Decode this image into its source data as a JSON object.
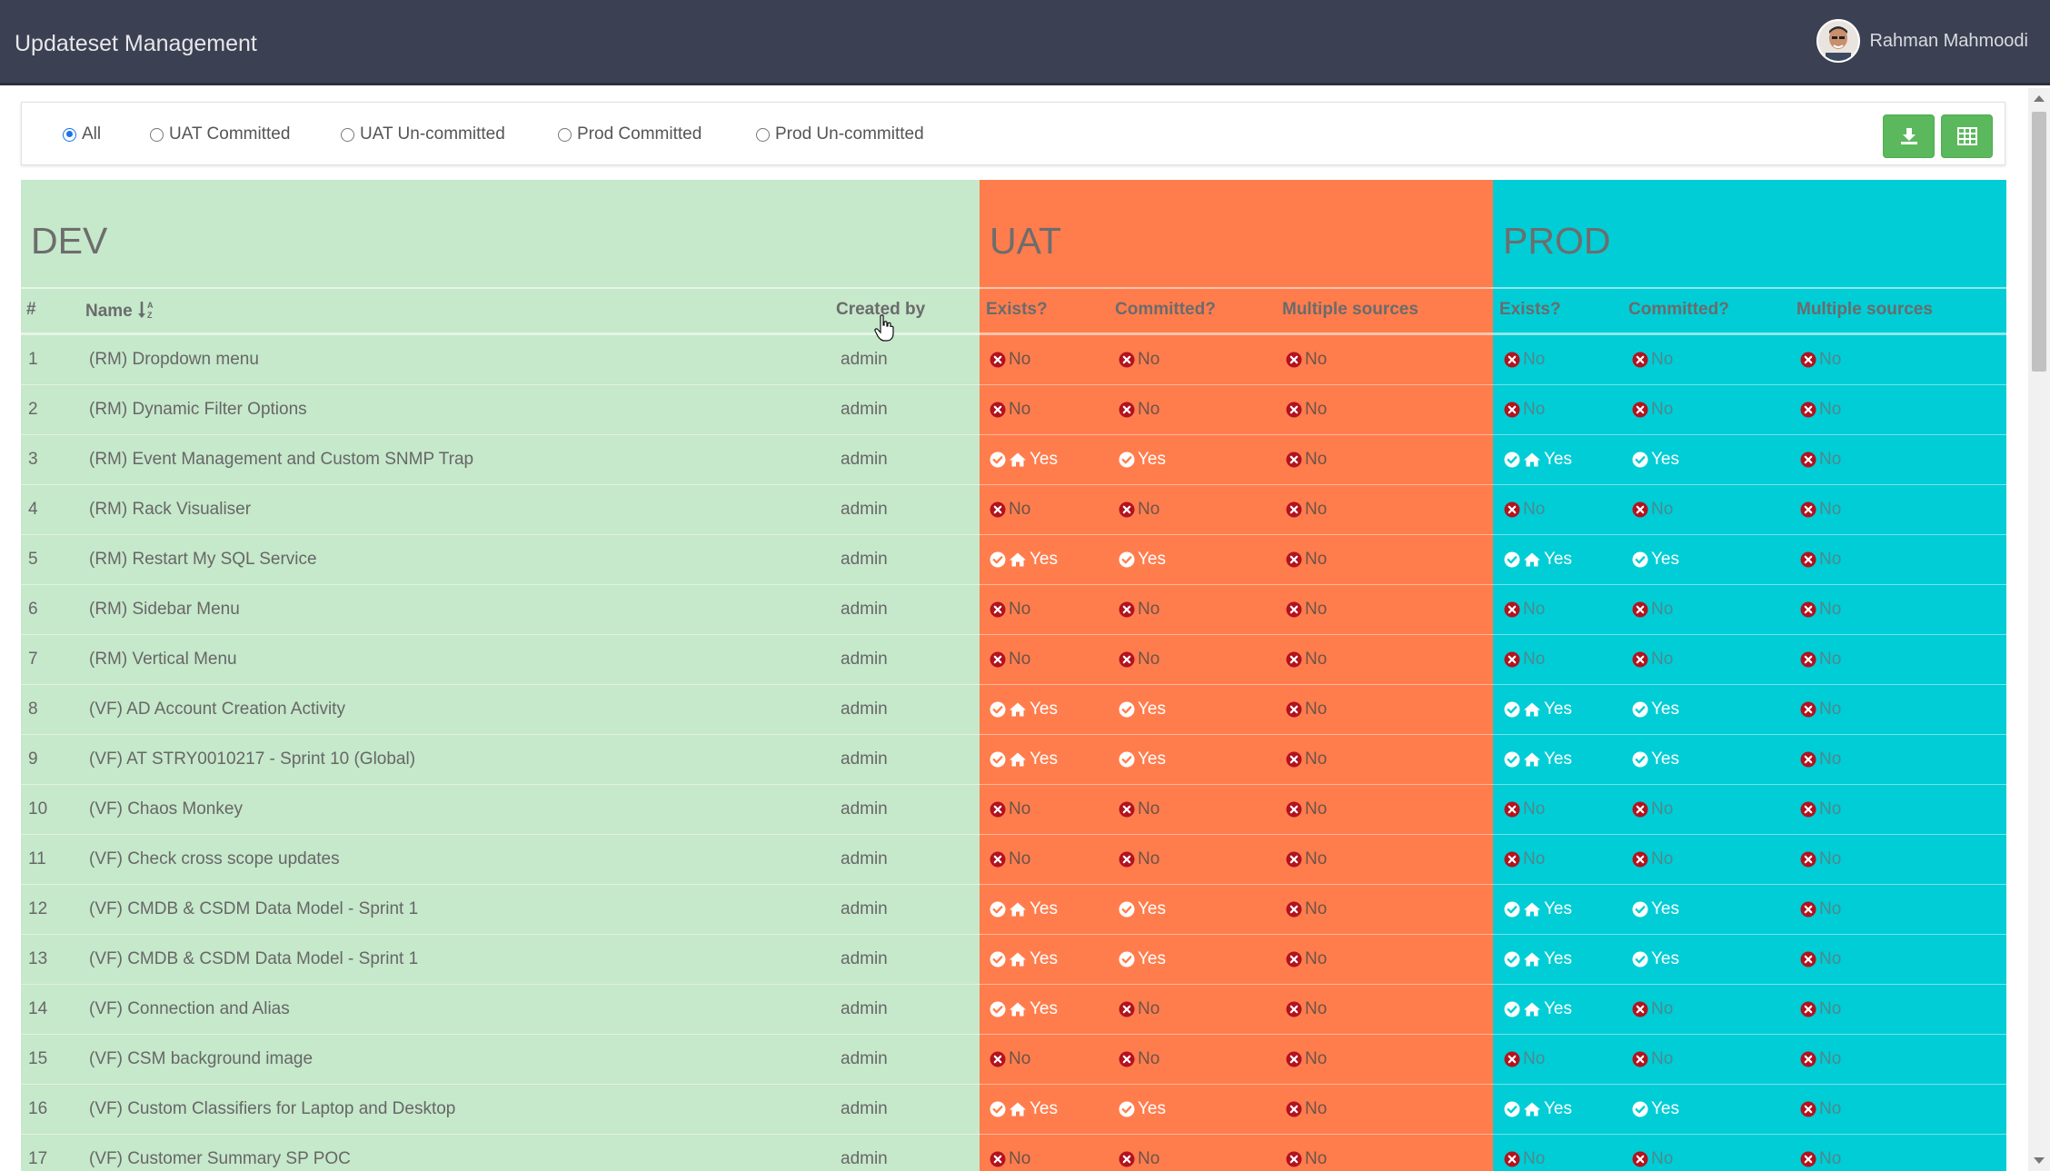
{
  "header": {
    "title": "Updateset Management",
    "user_name": "Rahman Mahmoodi"
  },
  "filters": {
    "options": [
      {
        "label": "All",
        "checked": true
      },
      {
        "label": "UAT Committed",
        "checked": false
      },
      {
        "label": "UAT Un-committed",
        "checked": false
      },
      {
        "label": "Prod Committed",
        "checked": false
      },
      {
        "label": "Prod Un-committed",
        "checked": false
      }
    ]
  },
  "toolbar": {
    "download_icon": "download-icon",
    "table_icon": "table-icon"
  },
  "sections": {
    "dev": "DEV",
    "uat": "UAT",
    "prod": "PROD"
  },
  "columns": {
    "num": "#",
    "name": "Name",
    "created_by": "Created by",
    "uat_exists": "Exists?",
    "uat_committed": "Committed?",
    "uat_multiple": "Multiple sources",
    "prod_exists": "Exists?",
    "prod_committed": "Committed?",
    "prod_multiple": "Multiple sources"
  },
  "colors": {
    "dev": "#c6e8cb",
    "uat": "#ff7d4d",
    "prod": "#00cdd6",
    "topbar": "#3b4052",
    "button": "#5cb85c"
  },
  "rows": [
    {
      "num": "1",
      "name": "(RM) Dropdown menu",
      "created_by": "admin",
      "uat_exists": "No",
      "uat_committed": "No",
      "uat_multiple": "No",
      "prod_exists": "No",
      "prod_committed": "No",
      "prod_multiple": "No"
    },
    {
      "num": "2",
      "name": "(RM) Dynamic Filter Options",
      "created_by": "admin",
      "uat_exists": "No",
      "uat_committed": "No",
      "uat_multiple": "No",
      "prod_exists": "No",
      "prod_committed": "No",
      "prod_multiple": "No"
    },
    {
      "num": "3",
      "name": "(RM) Event Management and Custom SNMP Trap",
      "created_by": "admin",
      "uat_exists": "Yes",
      "uat_committed": "Yes",
      "uat_multiple": "No",
      "prod_exists": "Yes",
      "prod_committed": "Yes",
      "prod_multiple": "No"
    },
    {
      "num": "4",
      "name": "(RM) Rack Visualiser",
      "created_by": "admin",
      "uat_exists": "No",
      "uat_committed": "No",
      "uat_multiple": "No",
      "prod_exists": "No",
      "prod_committed": "No",
      "prod_multiple": "No"
    },
    {
      "num": "5",
      "name": "(RM) Restart My SQL Service",
      "created_by": "admin",
      "uat_exists": "Yes",
      "uat_committed": "Yes",
      "uat_multiple": "No",
      "prod_exists": "Yes",
      "prod_committed": "Yes",
      "prod_multiple": "No"
    },
    {
      "num": "6",
      "name": "(RM) Sidebar Menu",
      "created_by": "admin",
      "uat_exists": "No",
      "uat_committed": "No",
      "uat_multiple": "No",
      "prod_exists": "No",
      "prod_committed": "No",
      "prod_multiple": "No"
    },
    {
      "num": "7",
      "name": "(RM) Vertical Menu",
      "created_by": "admin",
      "uat_exists": "No",
      "uat_committed": "No",
      "uat_multiple": "No",
      "prod_exists": "No",
      "prod_committed": "No",
      "prod_multiple": "No"
    },
    {
      "num": "8",
      "name": "(VF) AD Account Creation Activity",
      "created_by": "admin",
      "uat_exists": "Yes",
      "uat_committed": "Yes",
      "uat_multiple": "No",
      "prod_exists": "Yes",
      "prod_committed": "Yes",
      "prod_multiple": "No"
    },
    {
      "num": "9",
      "name": "(VF) AT STRY0010217 - Sprint 10 (Global)",
      "created_by": "admin",
      "uat_exists": "Yes",
      "uat_committed": "Yes",
      "uat_multiple": "No",
      "prod_exists": "Yes",
      "prod_committed": "Yes",
      "prod_multiple": "No"
    },
    {
      "num": "10",
      "name": "(VF) Chaos Monkey",
      "created_by": "admin",
      "uat_exists": "No",
      "uat_committed": "No",
      "uat_multiple": "No",
      "prod_exists": "No",
      "prod_committed": "No",
      "prod_multiple": "No"
    },
    {
      "num": "11",
      "name": "(VF) Check cross scope updates",
      "created_by": "admin",
      "uat_exists": "No",
      "uat_committed": "No",
      "uat_multiple": "No",
      "prod_exists": "No",
      "prod_committed": "No",
      "prod_multiple": "No"
    },
    {
      "num": "12",
      "name": "(VF) CMDB & CSDM Data Model - Sprint 1",
      "created_by": "admin",
      "uat_exists": "Yes",
      "uat_committed": "Yes",
      "uat_multiple": "No",
      "prod_exists": "Yes",
      "prod_committed": "Yes",
      "prod_multiple": "No"
    },
    {
      "num": "13",
      "name": "(VF) CMDB & CSDM Data Model - Sprint 1",
      "created_by": "admin",
      "uat_exists": "Yes",
      "uat_committed": "Yes",
      "uat_multiple": "No",
      "prod_exists": "Yes",
      "prod_committed": "Yes",
      "prod_multiple": "No"
    },
    {
      "num": "14",
      "name": "(VF) Connection and Alias",
      "created_by": "admin",
      "uat_exists": "Yes",
      "uat_committed": "No",
      "uat_multiple": "No",
      "prod_exists": "Yes",
      "prod_committed": "No",
      "prod_multiple": "No"
    },
    {
      "num": "15",
      "name": "(VF) CSM background image",
      "created_by": "admin",
      "uat_exists": "No",
      "uat_committed": "No",
      "uat_multiple": "No",
      "prod_exists": "No",
      "prod_committed": "No",
      "prod_multiple": "No"
    },
    {
      "num": "16",
      "name": "(VF) Custom Classifiers for Laptop and Desktop",
      "created_by": "admin",
      "uat_exists": "Yes",
      "uat_committed": "Yes",
      "uat_multiple": "No",
      "prod_exists": "Yes",
      "prod_committed": "Yes",
      "prod_multiple": "No"
    },
    {
      "num": "17",
      "name": "(VF) Customer Summary SP POC",
      "created_by": "admin",
      "uat_exists": "No",
      "uat_committed": "No",
      "uat_multiple": "No",
      "prod_exists": "No",
      "prod_committed": "No",
      "prod_multiple": "No"
    }
  ]
}
